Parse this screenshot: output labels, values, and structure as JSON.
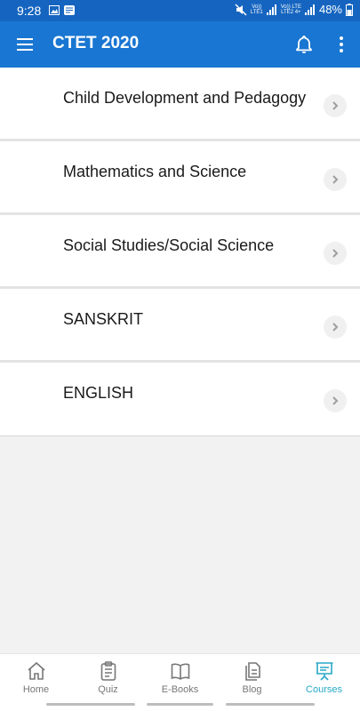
{
  "status_bar": {
    "time": "9:28",
    "net1_top": "Vo))",
    "net1_bottom": "LTE1",
    "net2_top": "Vo)) LTE",
    "net2_bottom": "LTE2 4+",
    "battery": "48%"
  },
  "app_bar": {
    "title": "CTET 2020",
    "icons": [
      "menu-icon",
      "bell-icon",
      "more-vert-icon"
    ]
  },
  "courses": [
    {
      "label": "Child Development and Pedagogy"
    },
    {
      "label": "Mathematics and Science"
    },
    {
      "label": "Social Studies/Social Science"
    },
    {
      "label": "SANSKRIT"
    },
    {
      "label": "ENGLISH"
    }
  ],
  "bottom_nav": {
    "items": [
      {
        "label": "Home",
        "icon": "home-icon"
      },
      {
        "label": "Quiz",
        "icon": "quiz-clipboard-icon"
      },
      {
        "label": "E-Books",
        "icon": "book-icon"
      },
      {
        "label": "Blog",
        "icon": "blog-document-icon"
      },
      {
        "label": "Courses",
        "icon": "courses-presentation-icon"
      }
    ],
    "active": "Courses",
    "active_color": "#26a8c8"
  },
  "colors": {
    "app_bar": "#1976d2",
    "status_bar": "#1565c0"
  }
}
